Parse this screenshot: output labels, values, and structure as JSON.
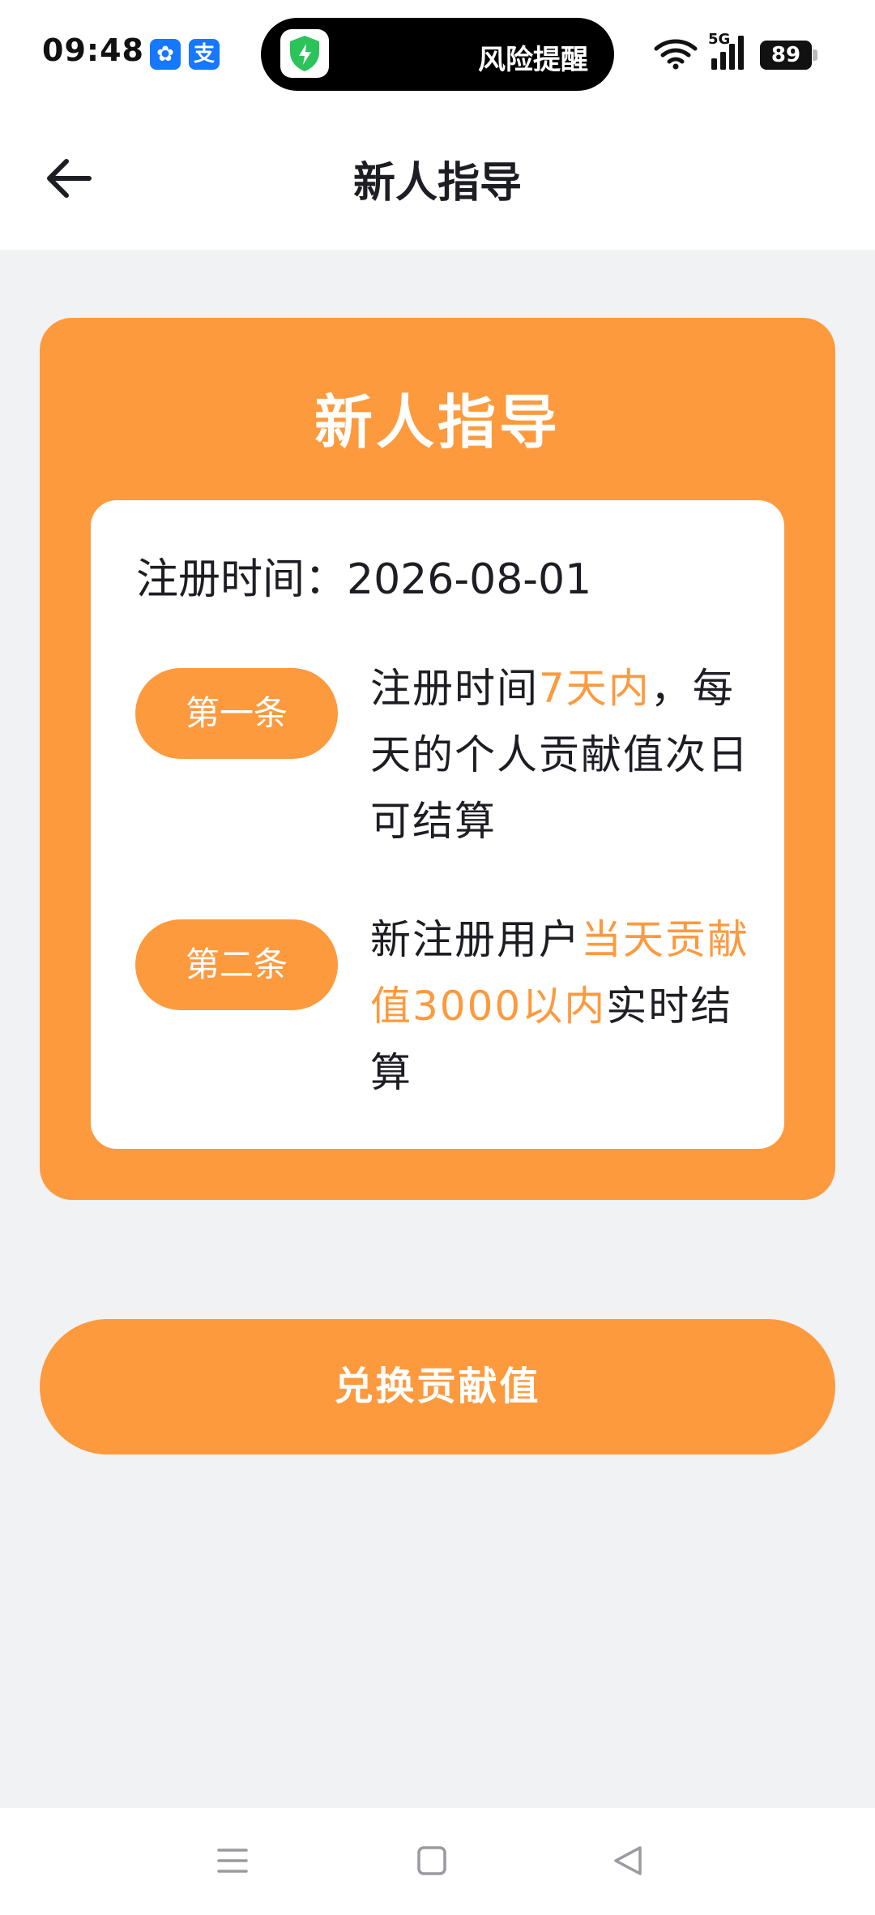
{
  "status_bar": {
    "time": "09:48",
    "app_badge_1": "✿",
    "app_badge_2": "支",
    "island_text": "风险提醒",
    "network_type": "5G",
    "battery": "89"
  },
  "nav": {
    "title": "新人指导"
  },
  "card": {
    "title": "新人指导",
    "registration_label": "注册时间：",
    "registration_date": "2026-08-01",
    "rules": [
      {
        "badge": "第一条",
        "part1": "注册时间",
        "highlight": "7天内",
        "part2": "，每天的个人贡献值次日可结算"
      },
      {
        "badge": "第二条",
        "part1": "新注册用户",
        "highlight": "当天贡献值3000以内",
        "part2": "实时结算"
      }
    ]
  },
  "action": {
    "exchange_label": "兑换贡献值"
  },
  "colors": {
    "accent": "#fd9a3e",
    "page_bg": "#f1f2f4",
    "text": "#1d1d24"
  }
}
